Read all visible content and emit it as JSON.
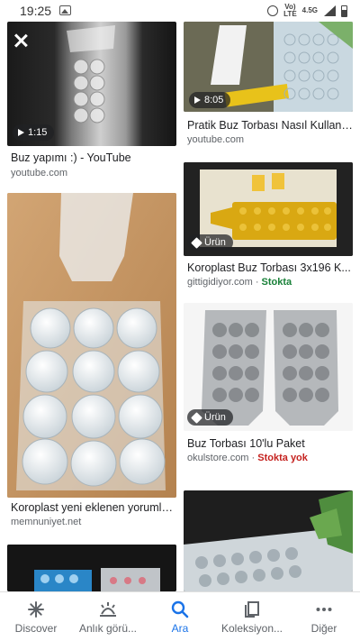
{
  "status_bar": {
    "time": "19:25",
    "network_lte": "LTE",
    "network_4g": "4.5G"
  },
  "results": [
    {
      "id": "r1",
      "caption": "Buz yapımı :) - YouTube",
      "source": "youtube.com",
      "badge": "1:15",
      "badge_type": "video"
    },
    {
      "id": "r2",
      "caption": "Pratik Buz Torbası Nasıl Kullanı...",
      "source": "youtube.com",
      "badge": "8:05",
      "badge_type": "video"
    },
    {
      "id": "r3",
      "caption": "Koroplast Buz Torbası 3x196 K...",
      "source": "gittigidiyor.com",
      "stock": "Stokta",
      "stock_state": "in",
      "badge": "Ürün",
      "badge_type": "product"
    },
    {
      "id": "r4",
      "caption": "Koroplast yeni eklenen yorumla...",
      "source": "memnuniyet.net"
    },
    {
      "id": "r5",
      "caption": "Buz Torbası 10'lu Paket",
      "source": "okulstore.com",
      "stock": "Stokta yok",
      "stock_state": "out",
      "badge": "Ürün",
      "badge_type": "product"
    }
  ],
  "source_separator": " · ",
  "bottom_nav": [
    {
      "label": "Discover",
      "icon": "asterisk-icon",
      "active": false
    },
    {
      "label": "Anlık görü...",
      "icon": "updates-icon",
      "active": false
    },
    {
      "label": "Ara",
      "icon": "search-icon",
      "active": true
    },
    {
      "label": "Koleksiyon...",
      "icon": "collections-icon",
      "active": false
    },
    {
      "label": "Diğer",
      "icon": "more-icon",
      "active": false
    }
  ],
  "colors": {
    "active": "#1a73e8",
    "in_stock": "#188038",
    "out_of_stock": "#c5221f"
  }
}
